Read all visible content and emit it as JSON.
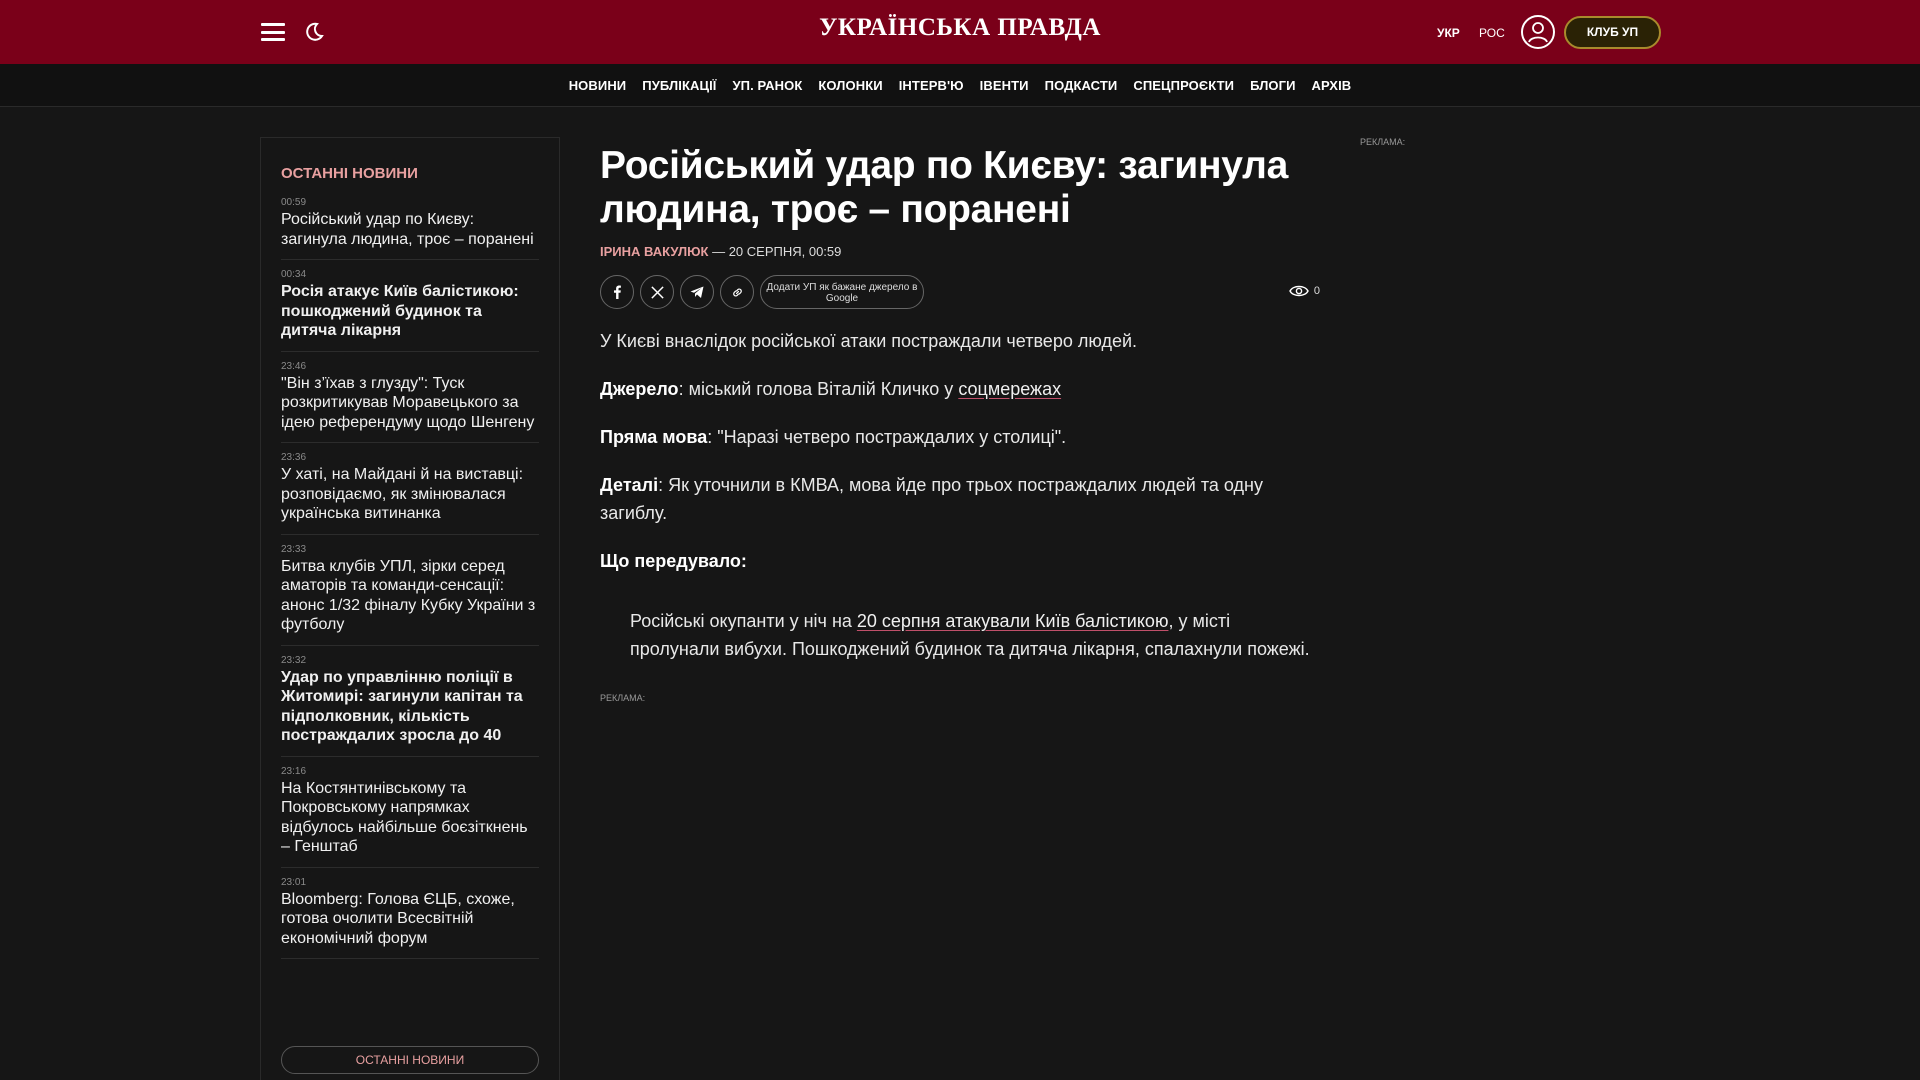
{
  "header": {
    "logo": "УКРАЇНСЬКА ПРАВДА",
    "lang_ukr": "УКР",
    "lang_ros": "РОС",
    "club_label": "КЛУБ УП"
  },
  "nav": [
    "НОВИНИ",
    "ПУБЛІКАЦІЇ",
    "УП. РАНОК",
    "КОЛОНКИ",
    "ІНТЕРВ'Ю",
    "ІВЕНТИ",
    "ПОДКАСТИ",
    "СПЕЦПРОЄКТИ",
    "БЛОГИ",
    "АРХІВ"
  ],
  "sidebar": {
    "title": "ОСТАННІ НОВИНИ",
    "items": [
      {
        "time": "00:59",
        "text": "Російський удар по Києву: загинула людина, троє – поранені",
        "bold": false
      },
      {
        "time": "00:34",
        "text": "Росія атакує Київ балістикою: пошкоджений будинок та дитяча лікарня",
        "bold": true
      },
      {
        "time": "23:46",
        "text": "\"Він з’їхав з глузду\": Туск розкритикував Моравецького за ідею референдуму щодо Шенгену",
        "bold": false
      },
      {
        "time": "23:36",
        "text": "У хаті, на Майдані й на виставці: розповідаємо, як змінювалася українська витинанка",
        "bold": false
      },
      {
        "time": "23:33",
        "text": "Битва клубів УПЛ, зірки серед аматорів та команди-сенсації: анонс 1/32 фіналу Кубку України з футболу",
        "bold": false
      },
      {
        "time": "23:32",
        "text": "Удар по управлінню поліції в Житомирі: загинули капітан та підполковник, кількість постраждалих зросла до 40",
        "bold": true
      },
      {
        "time": "23:16",
        "text": "На Костянтинівському та Покровському напрямках відбулось найбільше боєзіткнень – Генштаб",
        "bold": false
      },
      {
        "time": "23:01",
        "text": "Bloomberg: Голова ЄЦБ, схоже, готова очолити Всесвітній економічний форум",
        "bold": false
      }
    ],
    "more_label": "ОСТАННІ НОВИНИ"
  },
  "article": {
    "title": "Російський удар по Києву: загинула людина, троє – поранені",
    "author": "ІРИНА ВАКУЛЮК",
    "date": " — 20 СЕРПНЯ, 00:59",
    "google_label": "Додати УП як бажане джерело в Google",
    "views": "0",
    "p1": "У Києві внаслідок російської атаки постраждали четверо людей.",
    "source_label": "Джерело",
    "source_text": ": міський голова Віталій Кличко у ",
    "source_link": "соцмережах",
    "speech_label": "Пряма мова",
    "speech_text": ": \"Наразі четверо постраждалих у столиці\".",
    "details_label": "Деталі",
    "details_text": ": Як уточнили в КМВА, мова йде про трьох постраждалих людей та одну загиблу.",
    "prev_label": "Що передувало:",
    "quote_pre": "Російські окупанти у ніч на ",
    "quote_link": "20 серпня атакували Київ балістикою",
    "quote_post": ", у місті пролунали вибухи. Пошкоджений будинок та дитяча лікарня, спалахнули пожежі.",
    "ad_label": "РЕКЛАМА:"
  },
  "right_ad_label": "РЕКЛАМА:"
}
